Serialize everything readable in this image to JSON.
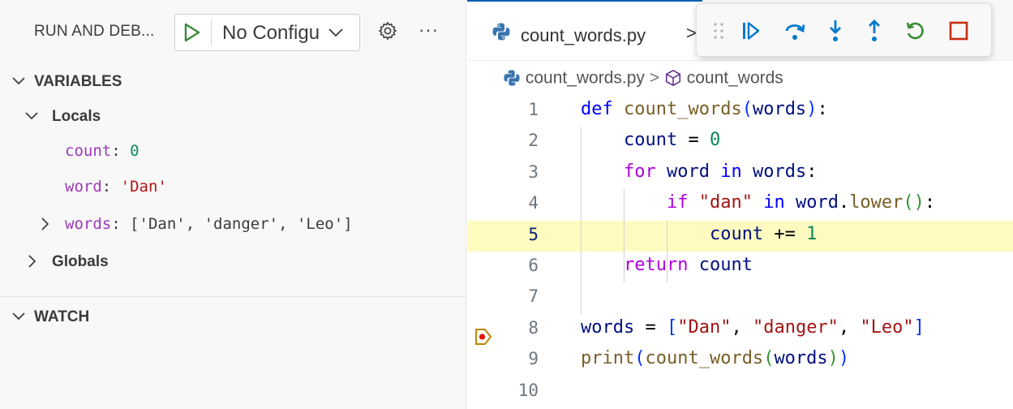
{
  "sidebar": {
    "title": "RUN AND DEB...",
    "config": {
      "selected": "No Configu"
    },
    "sections": {
      "variables": "VARIABLES",
      "locals": "Locals",
      "globals": "Globals",
      "watch": "WATCH"
    },
    "locals": [
      {
        "name": "count",
        "sep": ": ",
        "value": "0",
        "kind": "number"
      },
      {
        "name": "word",
        "sep": ": ",
        "value": "'Dan'",
        "kind": "string"
      },
      {
        "name": "words",
        "sep": ": ",
        "value": "['Dan', 'danger', 'Leo']",
        "kind": "plain"
      }
    ]
  },
  "editor": {
    "tab": {
      "label": "count_words.py",
      "overflow": ">"
    },
    "breadcrumb": {
      "file": "count_words.py",
      "sep": ">",
      "symbol": "count_words"
    },
    "current_line": 5,
    "line_numbers": [
      "1",
      "2",
      "3",
      "4",
      "5",
      "6",
      "7",
      "8",
      "9",
      "10"
    ],
    "code": [
      [
        [
          "kw",
          "def"
        ],
        [
          "op",
          " "
        ],
        [
          "fn",
          "count_words"
        ],
        [
          "br1",
          "("
        ],
        [
          "pm",
          "words"
        ],
        [
          "br1",
          ")"
        ],
        [
          "op",
          ":"
        ]
      ],
      [
        [
          "op",
          "    "
        ],
        [
          "pm",
          "count"
        ],
        [
          "op",
          " = "
        ],
        [
          "nm",
          "0"
        ]
      ],
      [
        [
          "op",
          "    "
        ],
        [
          "kwc",
          "for"
        ],
        [
          "op",
          " "
        ],
        [
          "pm",
          "word"
        ],
        [
          "op",
          " "
        ],
        [
          "kw",
          "in"
        ],
        [
          "op",
          " "
        ],
        [
          "pm",
          "words"
        ],
        [
          "op",
          ":"
        ]
      ],
      [
        [
          "op",
          "        "
        ],
        [
          "kwc",
          "if"
        ],
        [
          "op",
          " "
        ],
        [
          "st",
          "\"dan\""
        ],
        [
          "op",
          " "
        ],
        [
          "kw",
          "in"
        ],
        [
          "op",
          " "
        ],
        [
          "pm",
          "word"
        ],
        [
          "op",
          "."
        ],
        [
          "fn",
          "lower"
        ],
        [
          "br2",
          "()"
        ],
        [
          "op",
          ":"
        ]
      ],
      [
        [
          "op",
          "            "
        ],
        [
          "pm",
          "count"
        ],
        [
          "op",
          " += "
        ],
        [
          "nm",
          "1"
        ]
      ],
      [
        [
          "op",
          "    "
        ],
        [
          "kwc",
          "return"
        ],
        [
          "op",
          " "
        ],
        [
          "pm",
          "count"
        ]
      ],
      [],
      [
        [
          "pm",
          "words"
        ],
        [
          "op",
          " = "
        ],
        [
          "br1",
          "["
        ],
        [
          "st",
          "\"Dan\""
        ],
        [
          "op",
          ", "
        ],
        [
          "st",
          "\"danger\""
        ],
        [
          "op",
          ", "
        ],
        [
          "st",
          "\"Leo\""
        ],
        [
          "br1",
          "]"
        ]
      ],
      [
        [
          "fn",
          "print"
        ],
        [
          "br1",
          "("
        ],
        [
          "fn",
          "count_words"
        ],
        [
          "br2",
          "("
        ],
        [
          "pm",
          "words"
        ],
        [
          "br2",
          ")"
        ],
        [
          "br1",
          ")"
        ]
      ],
      []
    ]
  },
  "debug_toolbar": {
    "buttons": [
      "continue",
      "step-over",
      "step-into",
      "step-out",
      "restart",
      "stop"
    ]
  },
  "colors": {
    "accent": "#005fb8",
    "debug_green": "#388a34",
    "debug_blue": "#007acc",
    "stop_red": "#c72e0f",
    "current_line": "#fffbc0"
  }
}
